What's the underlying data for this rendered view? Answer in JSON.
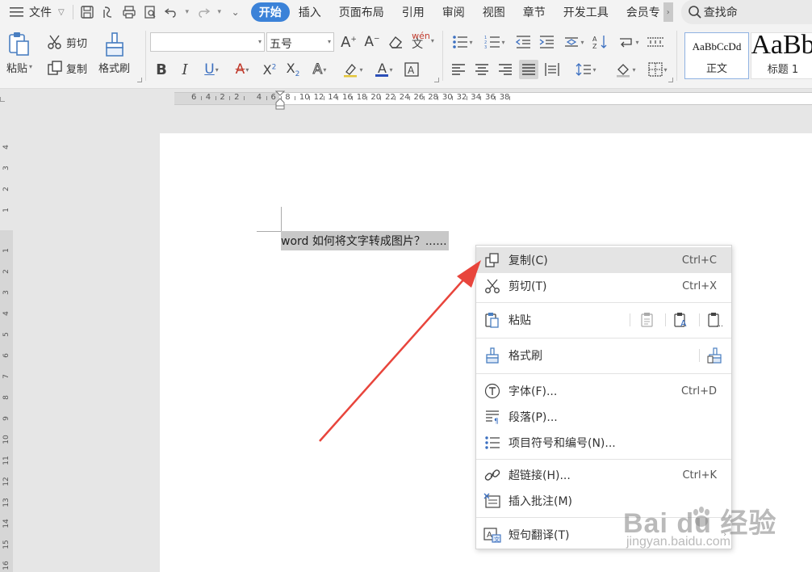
{
  "menubar": {
    "file_label": "文件",
    "tabs": [
      {
        "label": "开始",
        "active": true
      },
      {
        "label": "插入"
      },
      {
        "label": "页面布局"
      },
      {
        "label": "引用"
      },
      {
        "label": "审阅"
      },
      {
        "label": "视图"
      },
      {
        "label": "章节"
      },
      {
        "label": "开发工具"
      },
      {
        "label": "会员专"
      }
    ],
    "search_label": "查找命"
  },
  "ribbon": {
    "paste_label": "粘贴",
    "cut_label": "剪切",
    "copy_label": "复制",
    "format_painter_label": "格式刷",
    "font_name": "",
    "font_size": "五号",
    "styles": [
      {
        "sample": "AaBbCcDd",
        "name": "正文"
      },
      {
        "sample": "AaBb",
        "name": "标题 1"
      }
    ]
  },
  "ruler": {
    "h_ticks": [
      "6",
      "4",
      "2",
      "2",
      "4",
      "6",
      "8",
      "10",
      "12",
      "14",
      "16",
      "18",
      "20",
      "22",
      "24",
      "26",
      "28",
      "30",
      "32",
      "34",
      "36",
      "38"
    ],
    "v_ticks_top": [
      "4",
      "3",
      "2",
      "1"
    ],
    "v_ticks_body": [
      "1",
      "2",
      "3",
      "4",
      "5",
      "6",
      "7",
      "8",
      "9",
      "10",
      "11",
      "12",
      "13",
      "14",
      "15",
      "16"
    ]
  },
  "document": {
    "selected_text": "word 如何将文字转成图片？......"
  },
  "context_menu": {
    "items": [
      {
        "label": "复制(C)",
        "shortcut": "Ctrl+C",
        "icon": "copy-icon"
      },
      {
        "label": "剪切(T)",
        "shortcut": "Ctrl+X",
        "icon": "scissors-icon"
      },
      {
        "label": "粘贴",
        "shortcut": "",
        "icon": "paste-icon"
      },
      {
        "label": "格式刷",
        "shortcut": "",
        "icon": "format-painter-icon"
      },
      {
        "label": "字体(F)...",
        "shortcut": "Ctrl+D",
        "icon": "font-icon"
      },
      {
        "label": "段落(P)...",
        "shortcut": "",
        "icon": "paragraph-icon"
      },
      {
        "label": "项目符号和编号(N)...",
        "shortcut": "",
        "icon": "bullets-icon"
      },
      {
        "label": "超链接(H)...",
        "shortcut": "Ctrl+K",
        "icon": "link-icon"
      },
      {
        "label": "插入批注(M)",
        "shortcut": "",
        "icon": "comment-icon"
      },
      {
        "label": "短句翻译(T)",
        "shortcut": "",
        "icon": "translate-icon"
      }
    ]
  },
  "watermark": {
    "logo": "Bai du 经验",
    "url": "jingyan.baidu.com"
  },
  "colors": {
    "accent": "#3b82d8",
    "arrow": "#e8453c",
    "selection": "#c8c8c8",
    "menu_highlight": "#e4e4e4"
  }
}
